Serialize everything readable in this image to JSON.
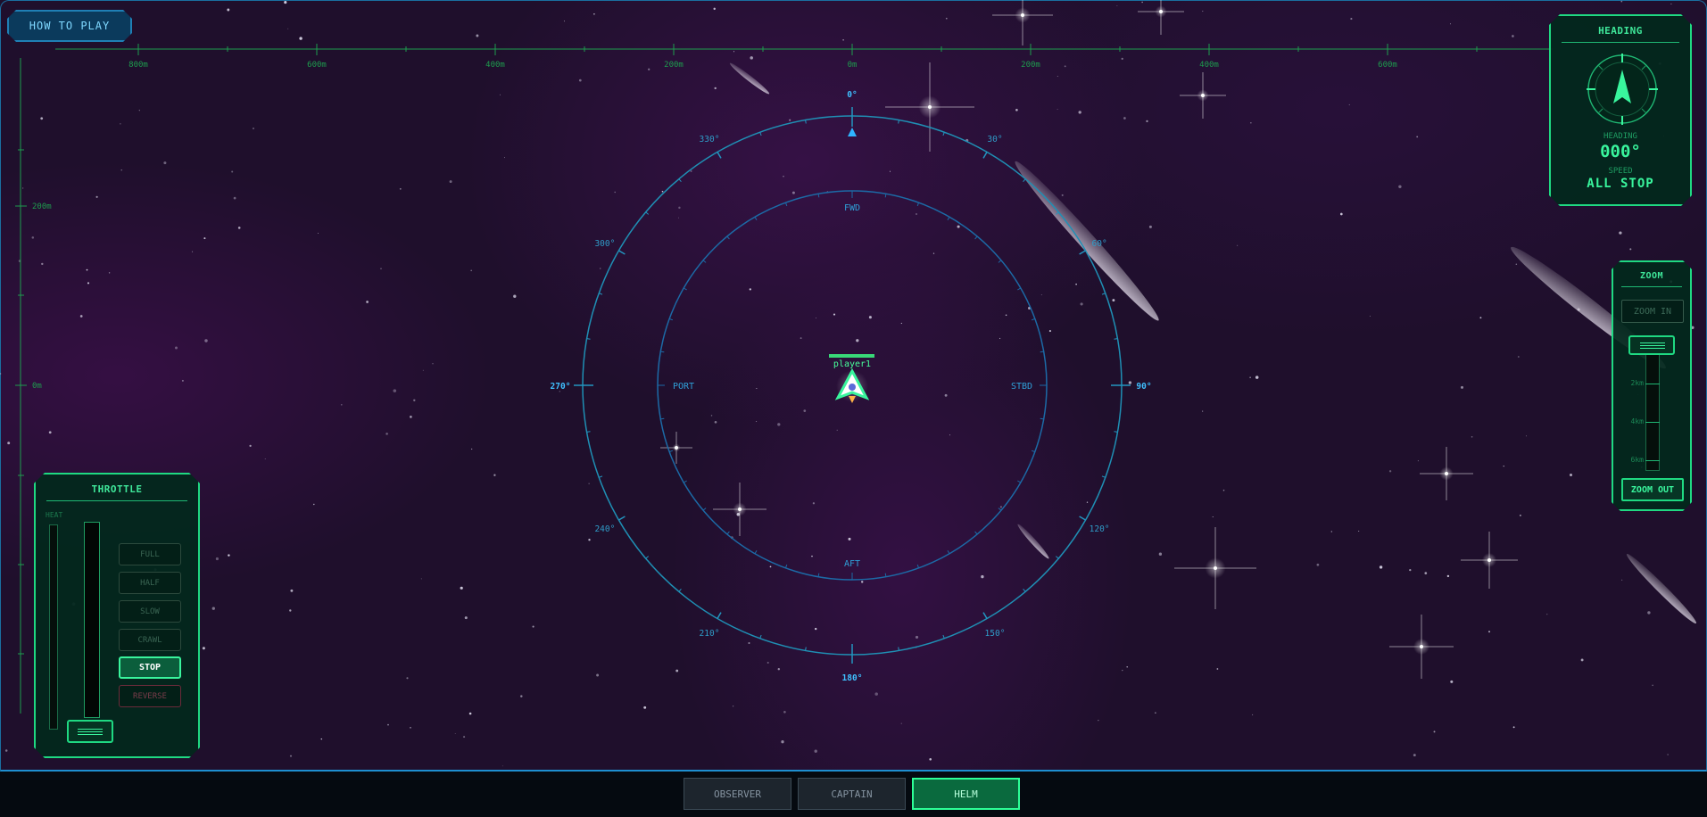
{
  "buttons": {
    "how_to_play": "HOW TO PLAY"
  },
  "ruler": {
    "horizontal_labels": [
      "800m",
      "600m",
      "400m",
      "200m",
      "0m",
      "200m",
      "400m",
      "600m"
    ],
    "vertical_labels": [
      "200m",
      "0m"
    ]
  },
  "radar": {
    "degree_labels": [
      "0°",
      "30°",
      "60°",
      "90°",
      "120°",
      "150°",
      "180°",
      "210°",
      "240°",
      "270°",
      "300°",
      "330°"
    ],
    "direction_labels": {
      "fwd": "FWD",
      "aft": "AFT",
      "port": "PORT",
      "stbd": "STBD"
    },
    "color": "#1f8fb4"
  },
  "ship": {
    "name": "player1",
    "color": "#39f59d"
  },
  "heading_panel": {
    "title": "HEADING",
    "heading_label": "HEADING",
    "heading_value": "000°",
    "speed_label": "SPEED",
    "speed_value": "ALL STOP"
  },
  "zoom_panel": {
    "title": "ZOOM",
    "zoom_in": "ZOOM IN",
    "zoom_out": "ZOOM OUT",
    "ticks": [
      "2km",
      "4km",
      "6km"
    ]
  },
  "throttle_panel": {
    "title": "THROTTLE",
    "heat_label": "HEAT",
    "buttons": [
      "FULL",
      "HALF",
      "SLOW",
      "CRAWL",
      "STOP",
      "REVERSE"
    ],
    "active": "STOP"
  },
  "roles": {
    "observer": "OBSERVER",
    "captain": "CAPTAIN",
    "helm": "HELM",
    "active": "HELM"
  },
  "colors": {
    "accent": "#39f59d",
    "radar": "#1f8fb4",
    "background": "#1f0f2c"
  }
}
